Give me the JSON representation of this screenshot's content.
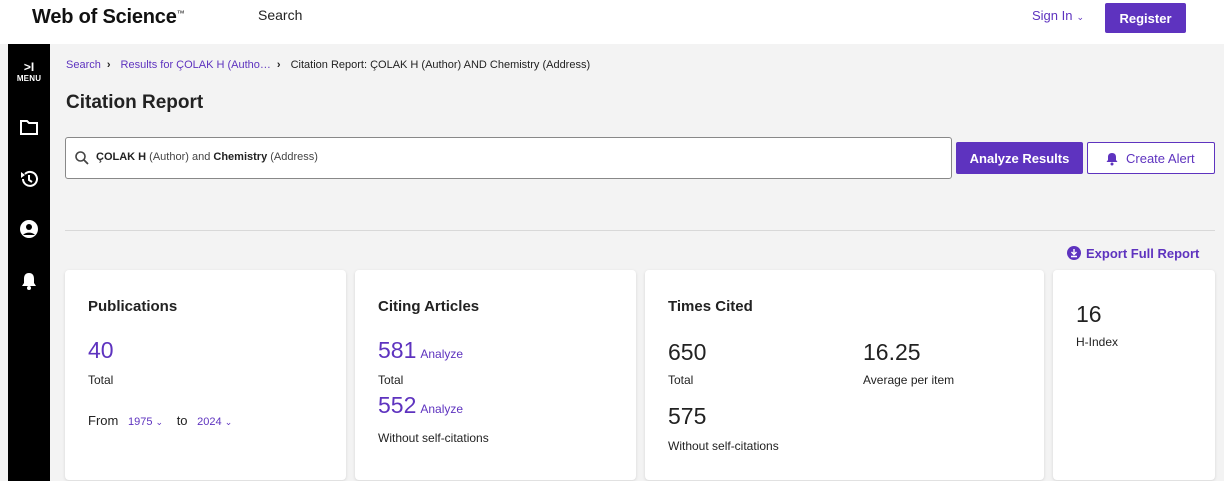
{
  "header": {
    "logo": "Web of Science",
    "logo_tm": "™",
    "search_link": "Search",
    "sign_in": "Sign In",
    "register": "Register"
  },
  "sidebar": {
    "toggle_arrow": ">I",
    "menu_label": "MENU",
    "icons": [
      "folder-icon",
      "history-icon",
      "user-icon",
      "bell-icon"
    ]
  },
  "breadcrumb": {
    "search": "Search",
    "results": "Results for ÇOLAK H (Autho…",
    "current": "Citation Report: ÇOLAK H (Author) AND Chemistry (Address)"
  },
  "page_title": "Citation Report",
  "search_query": {
    "term1": "ÇOLAK H",
    "field1": "(Author) and",
    "term2": "Chemistry",
    "field2": "(Address)"
  },
  "buttons": {
    "analyze_results": "Analyze Results",
    "create_alert": "Create Alert",
    "export_full_report": "Export Full Report"
  },
  "publications": {
    "title": "Publications",
    "count": "40",
    "count_label": "Total",
    "from_label": "From",
    "from_year": "1975",
    "to_label": "to",
    "to_year": "2024"
  },
  "citing_articles": {
    "title": "Citing Articles",
    "total": "581",
    "total_label": "Total",
    "without_self": "552",
    "without_self_label": "Without self-citations",
    "analyze_label": "Analyze"
  },
  "times_cited": {
    "title": "Times Cited",
    "total": "650",
    "total_label": "Total",
    "average": "16.25",
    "average_label": "Average per item",
    "without_self": "575",
    "without_self_label": "Without self-citations"
  },
  "h_index": {
    "value": "16",
    "label": "H-Index"
  },
  "colors": {
    "accent": "#5e33bf",
    "sidebar": "#000000",
    "background": "#f3f3f3"
  }
}
